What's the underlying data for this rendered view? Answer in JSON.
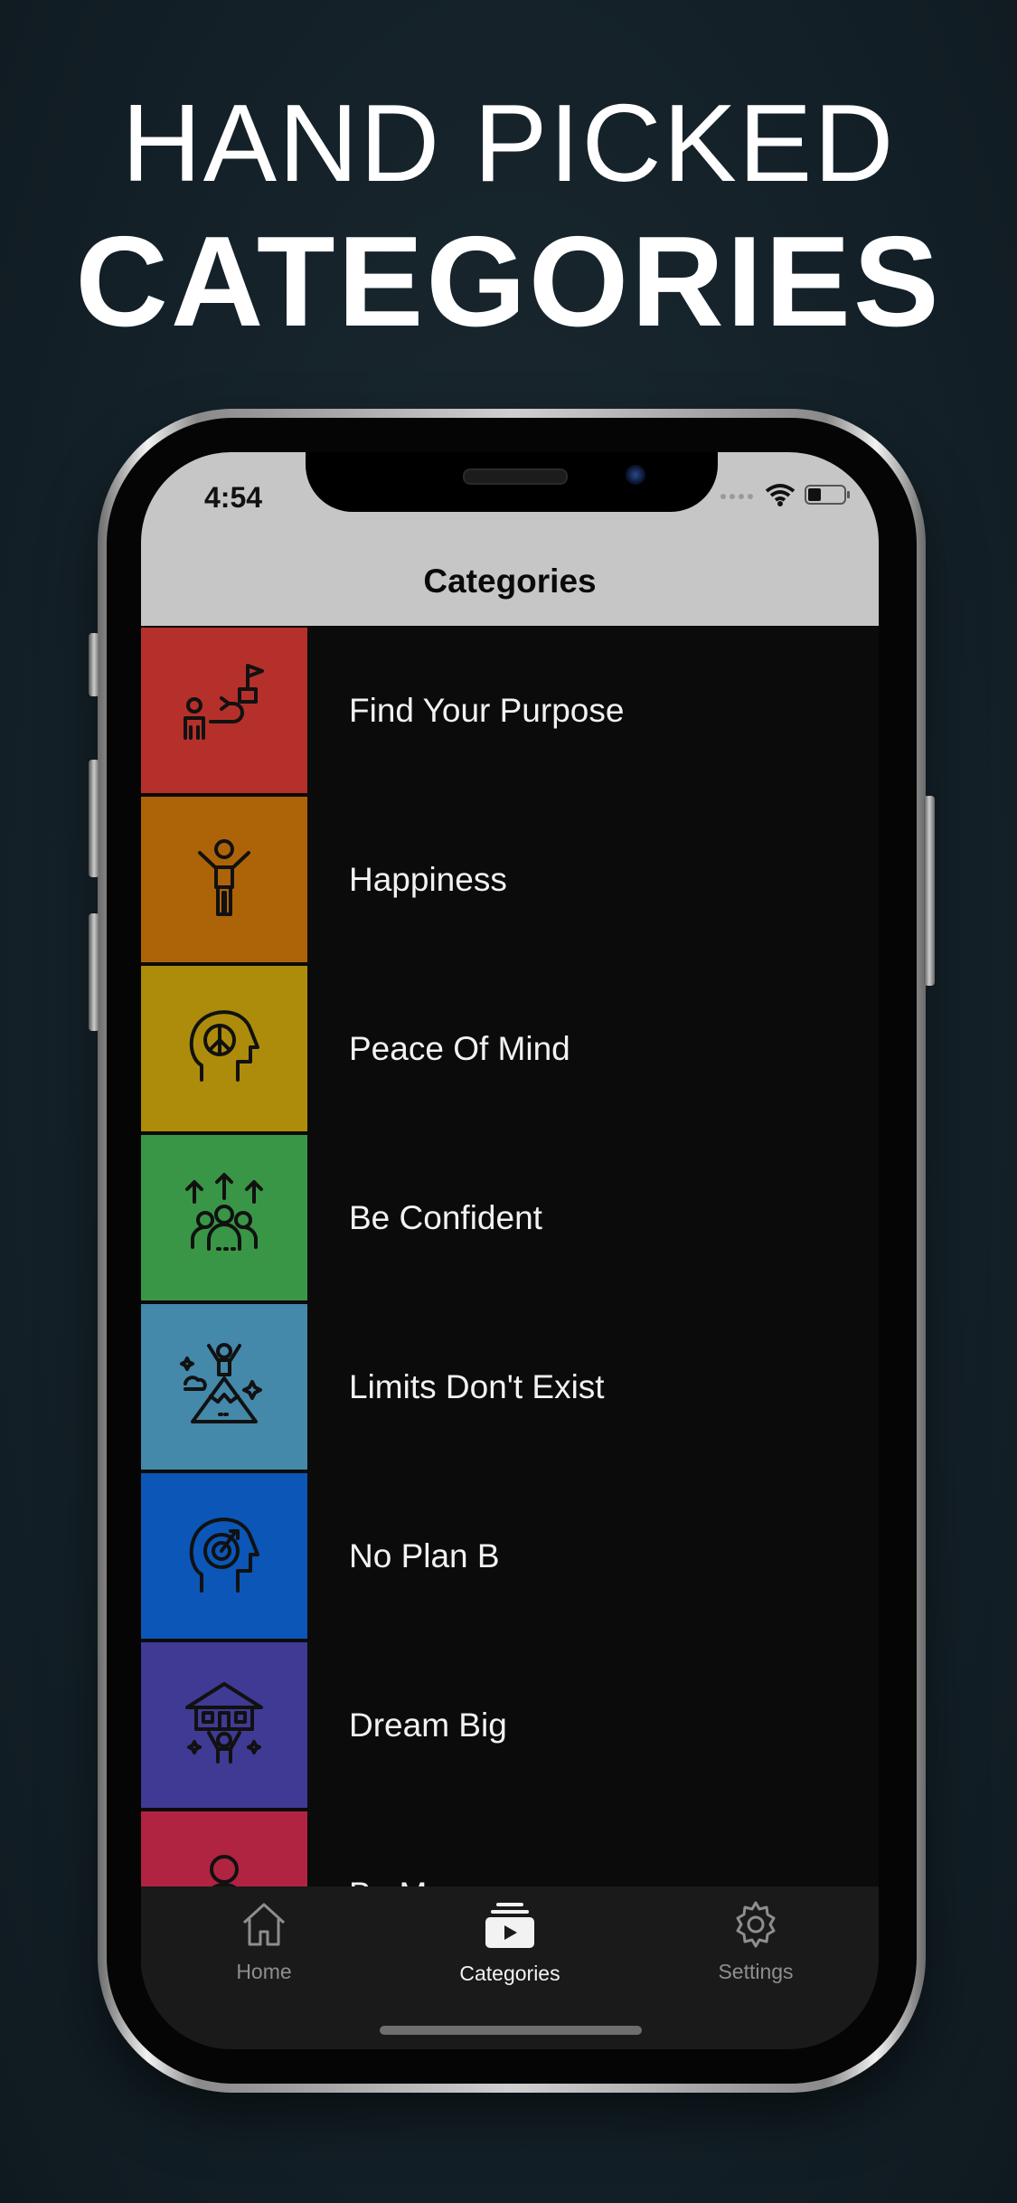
{
  "hero": {
    "line1": "HAND PICKED",
    "line2": "CATEGORIES"
  },
  "status_bar": {
    "time": "4:54",
    "icons": [
      "signal-dots-icon",
      "wifi-icon",
      "battery-icon"
    ]
  },
  "nav": {
    "title": "Categories"
  },
  "categories": [
    {
      "label": "Find Your Purpose",
      "color": "#b5302a",
      "icon": "purpose-path-icon"
    },
    {
      "label": "Happiness",
      "color": "#ad6409",
      "icon": "happy-person-icon"
    },
    {
      "label": "Peace Of Mind",
      "color": "#ad8c0b",
      "icon": "peace-head-icon"
    },
    {
      "label": "Be Confident",
      "color": "#399647",
      "icon": "confident-group-icon"
    },
    {
      "label": "Limits Don't Exist",
      "color": "#4488aa",
      "icon": "mountain-summit-icon"
    },
    {
      "label": "No Plan B",
      "color": "#0b56b6",
      "icon": "target-head-icon"
    },
    {
      "label": "Dream Big",
      "color": "#3f3a93",
      "icon": "dream-house-icon"
    },
    {
      "label": "Be Me",
      "color": "#b12441",
      "icon": "person-icon"
    }
  ],
  "tabs": [
    {
      "label": "Home",
      "icon": "home-icon",
      "active": false
    },
    {
      "label": "Categories",
      "icon": "categories-icon",
      "active": true
    },
    {
      "label": "Settings",
      "icon": "gear-icon",
      "active": false
    }
  ]
}
